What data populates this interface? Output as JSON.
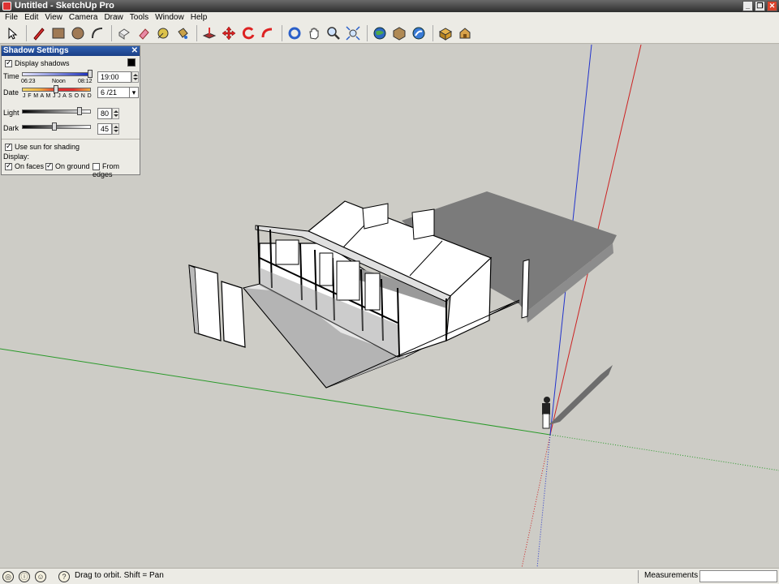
{
  "window": {
    "title": "Untitled - SketchUp Pro"
  },
  "menu": [
    "File",
    "Edit",
    "View",
    "Camera",
    "Draw",
    "Tools",
    "Window",
    "Help"
  ],
  "toolbar": {
    "tools": [
      "select-icon",
      "pencil-icon",
      "rectangle-icon",
      "circle-icon",
      "arc-icon",
      "eraser-box-icon",
      "eraser-icon",
      "paint-bucket-icon",
      "tape-measure-icon",
      "push-pull-icon",
      "move-icon",
      "rotate-icon",
      "follow-me-icon",
      "orbit-icon",
      "pan-icon",
      "zoom-icon",
      "zoom-extents-icon",
      "globe-icon",
      "get-models-icon",
      "share-model-icon",
      "components-icon",
      "warehouse-icon"
    ]
  },
  "shadow_settings": {
    "title": "Shadow Settings",
    "display_shadows_label": "Display shadows",
    "display_shadows": true,
    "time_label": "Time",
    "time_sunrise": "06:23",
    "time_noon": "Noon",
    "time_sunset": "08:12",
    "time_value": "19:00",
    "date_label": "Date",
    "date_months": "J F M A M J J A S O N D",
    "date_value": "6 /21",
    "light_label": "Light",
    "light_value": "80",
    "dark_label": "Dark",
    "dark_value": "45",
    "use_sun_label": "Use sun for shading",
    "use_sun": true,
    "display_label": "Display:",
    "on_faces_label": "On faces",
    "on_faces": true,
    "on_ground_label": "On ground",
    "on_ground": true,
    "from_edges_label": "From edges",
    "from_edges": false,
    "colors": {
      "title_bar": "#1b3f86"
    }
  },
  "status": {
    "hint": "Drag to orbit.  Shift = Pan",
    "measurements_label": "Measurements",
    "measurements_value": ""
  },
  "axes": {
    "red": "#cc2222",
    "green": "#2a9a2a",
    "blue": "#2233cc"
  }
}
